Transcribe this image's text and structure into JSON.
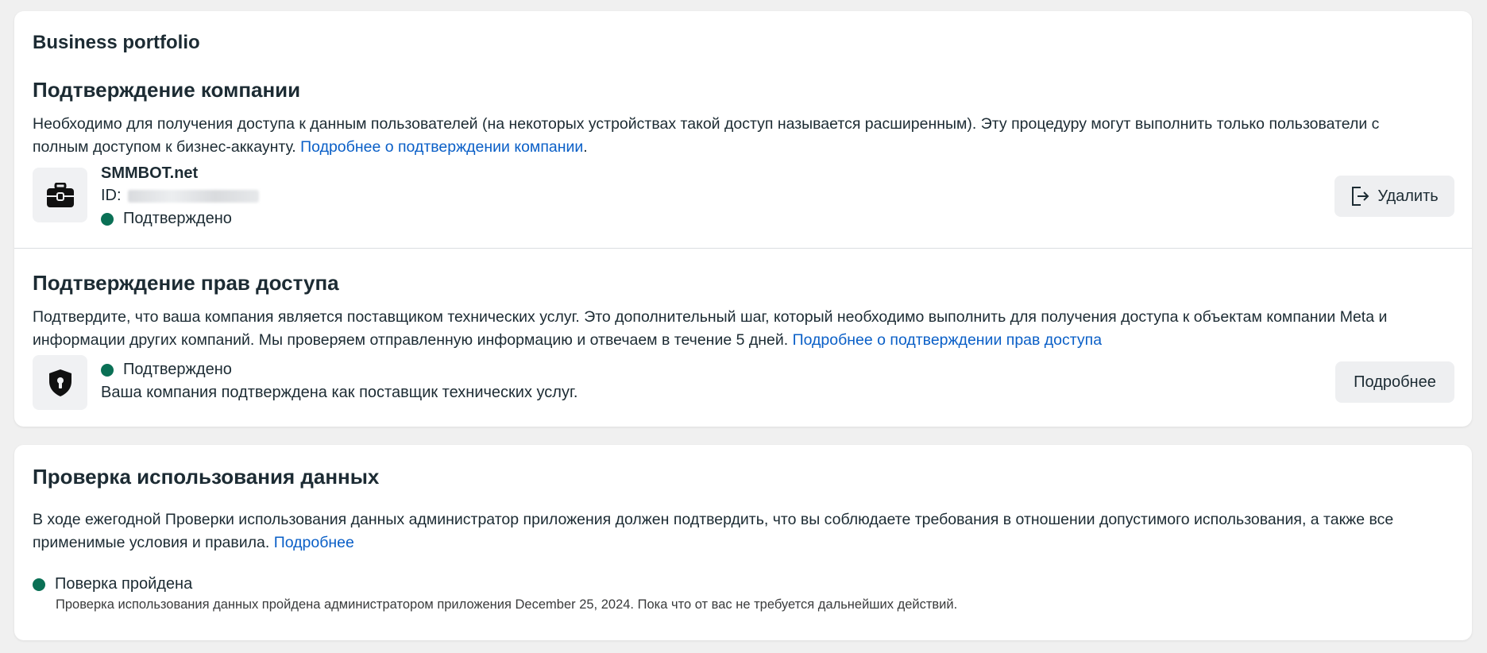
{
  "card1": {
    "portfolio_title": "Business portfolio",
    "company_verification": {
      "title": "Подтверждение компании",
      "text": "Необходимо для получения доступа к данным пользователей (на некоторых устройствах такой доступ называется расширенным). Эту процедуру могут выполнить только пользователи с полным доступом к бизнес-аккаунту.",
      "link": "Подробнее о подтверждении компании",
      "link_suffix": ".",
      "company_name": "SMMBOT.net",
      "id_label": "ID:",
      "status": "Подтверждено",
      "remove_button": "Удалить",
      "icon": "briefcase-icon"
    },
    "access_verification": {
      "title": "Подтверждение прав доступа",
      "text": "Подтвердите, что ваша компания является поставщиком технических услуг. Это дополнительный шаг, который необходимо выполнить для получения доступа к объектам компании Meta и информации других компаний. Мы проверяем отправленную информацию и отвечаем в течение 5 дней.",
      "link": "Подробнее о подтверждении прав доступа",
      "status": "Подтверждено",
      "description": "Ваша компания подтверждена как поставщик технических услуг.",
      "details_button": "Подробнее",
      "icon": "shield-lock-icon"
    }
  },
  "card2": {
    "title": "Проверка использования данных",
    "text": "В ходе ежегодной Проверки использования данных администратор приложения должен подтвердить, что вы соблюдаете требования в отношении допустимого использования, а также все применимые условия и правила.",
    "link": "Подробнее",
    "status": "Поверка пройдена",
    "status_detail": "Проверка использования данных пройдена администратором приложения December 25, 2024. Пока что от вас не требуется дальнейших действий."
  },
  "colors": {
    "status_green": "#0a7055",
    "link_blue": "#0a5fc7"
  }
}
